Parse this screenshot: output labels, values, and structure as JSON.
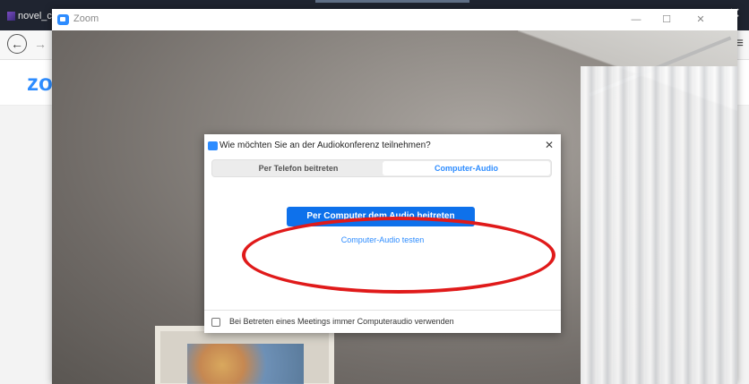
{
  "browser": {
    "tab_title": "novel_c",
    "close_glyph": "✕",
    "back_glyph": "←",
    "forward_glyph": "→",
    "menu_glyph": "≡",
    "ext_icon": "account-circle-icon"
  },
  "site": {
    "logo_text": "zo",
    "chevron_glyph": "⌄"
  },
  "zoom_window": {
    "title": "Zoom",
    "minimize_glyph": "—",
    "maximize_glyph": "☐",
    "close_glyph": "✕"
  },
  "audio_dialog": {
    "title": "Wie möchten Sie an der Audiokonferenz teilnehmen?",
    "close_glyph": "✕",
    "tabs": [
      {
        "label": "Per Telefon beitreten",
        "active": false
      },
      {
        "label": "Computer-Audio",
        "active": true
      }
    ],
    "join_button_label": "Per Computer dem Audio beitreten",
    "test_link_label": "Computer-Audio testen",
    "auto_audio_checkbox": {
      "label": "Bei Betreten eines Meetings immer Computeraudio verwenden",
      "checked": false
    }
  },
  "colors": {
    "zoom_blue": "#2d8cff",
    "button_blue": "#0e71eb",
    "annotation_red": "#e01a1a"
  }
}
